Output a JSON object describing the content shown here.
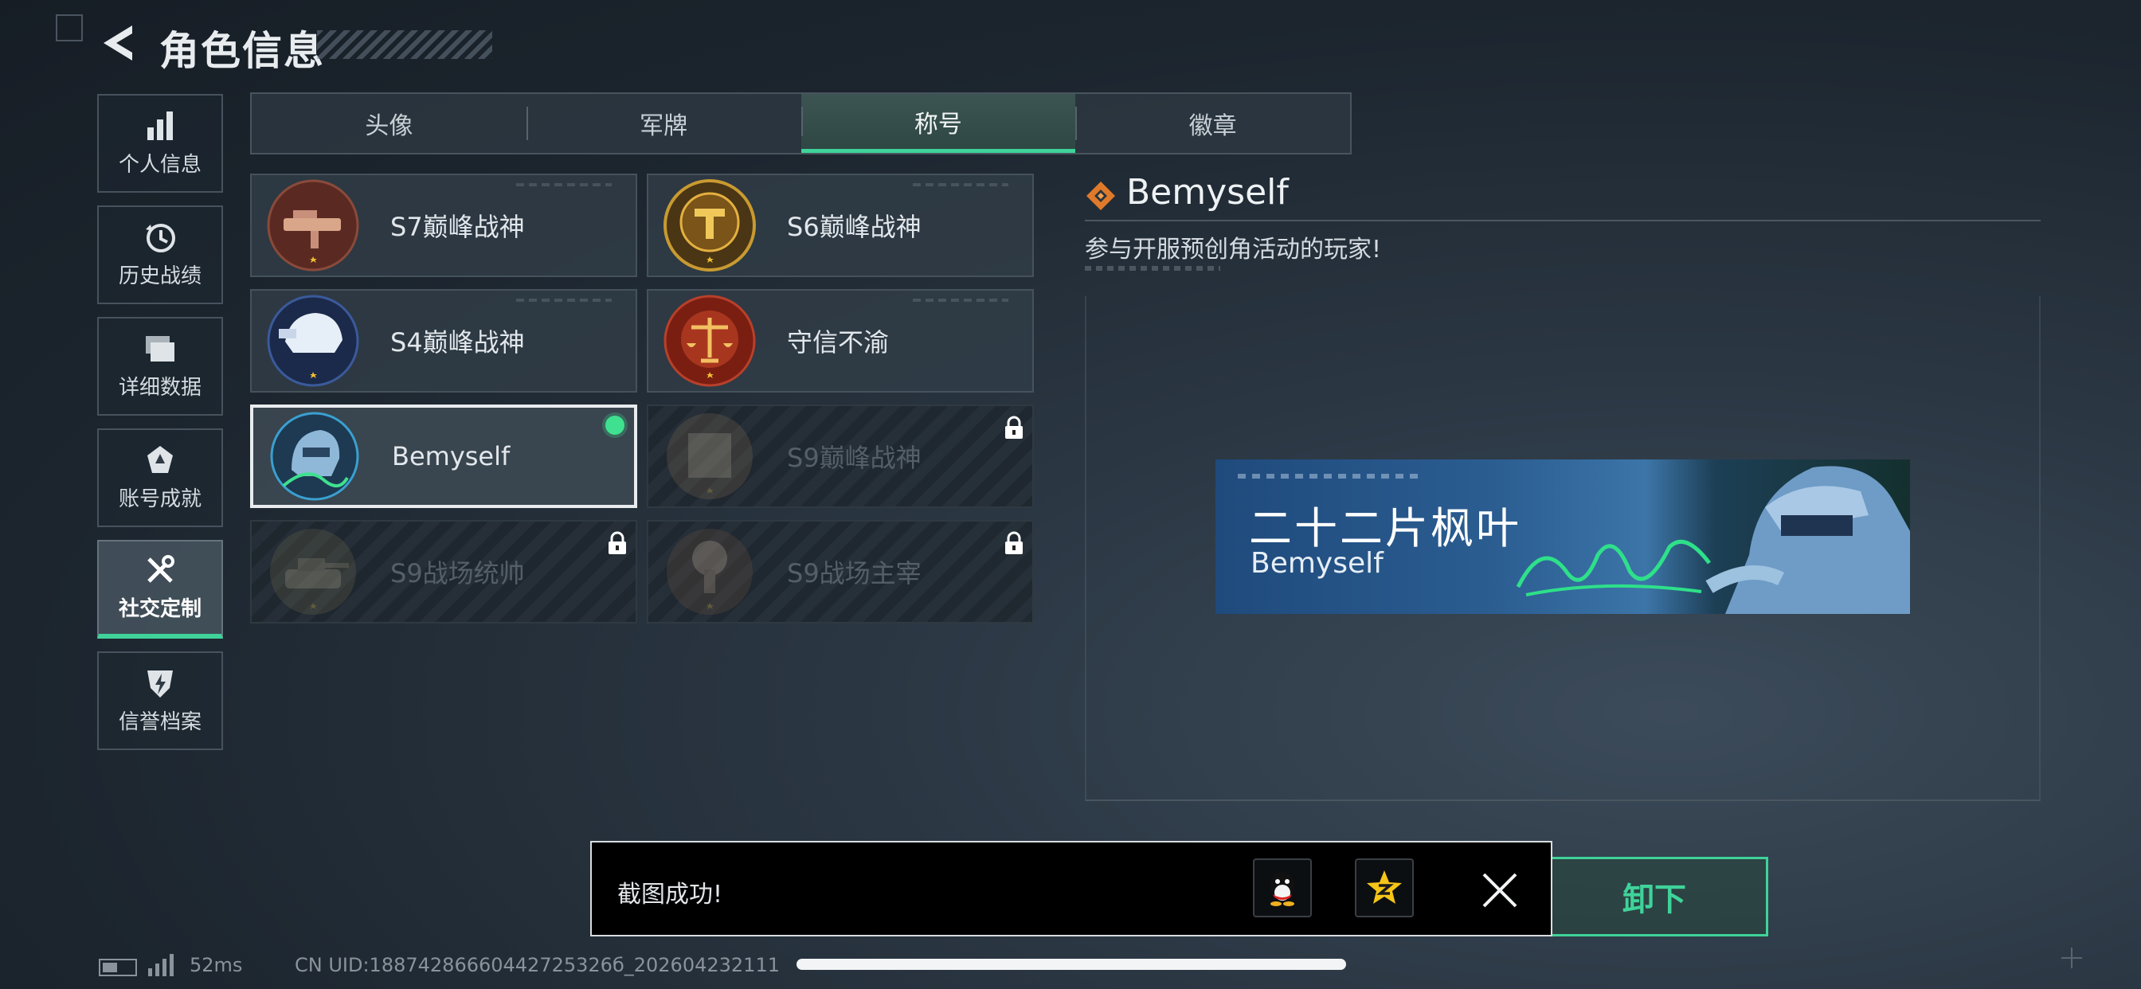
{
  "header": {
    "title": "角色信息"
  },
  "nav": {
    "items": [
      {
        "label": "个人信息",
        "icon": "bar-chart-icon"
      },
      {
        "label": "历史战绩",
        "icon": "clock-icon"
      },
      {
        "label": "详细数据",
        "icon": "folder-icon"
      },
      {
        "label": "账号成就",
        "icon": "achievement-icon"
      },
      {
        "label": "社交定制",
        "icon": "tools-icon",
        "active": true
      },
      {
        "label": "信誉档案",
        "icon": "shield-bolt-icon"
      }
    ]
  },
  "tabs": [
    {
      "label": "头像"
    },
    {
      "label": "军牌"
    },
    {
      "label": "称号",
      "active": true
    },
    {
      "label": "徽章"
    }
  ],
  "titles": [
    {
      "label": "S7巅峰战神",
      "locked": false
    },
    {
      "label": "S6巅峰战神",
      "locked": false
    },
    {
      "label": "S4巅峰战神",
      "locked": false
    },
    {
      "label": "守信不渝",
      "locked": false
    },
    {
      "label": "Bemyself",
      "locked": false,
      "selected": true,
      "equipped": true
    },
    {
      "label": "S9巅峰战神",
      "locked": true
    },
    {
      "label": "S9战场统帅",
      "locked": true
    },
    {
      "label": "S9战场主宰",
      "locked": true
    }
  ],
  "detail": {
    "name": "Bemyself",
    "description": "参与开服预创角活动的玩家!",
    "banner_title": "二十二片枫叶",
    "banner_subtitle": "Bemyself"
  },
  "equip_button": {
    "label": "卸下"
  },
  "toast": {
    "message": "截图成功!",
    "share_targets": [
      "qq-icon",
      "qzone-icon"
    ]
  },
  "status": {
    "ping": "52ms",
    "uid": "CN UID:18874286660442725326б_202604232111"
  },
  "colors": {
    "accent": "#3fd39a",
    "background": "#1c252e"
  }
}
